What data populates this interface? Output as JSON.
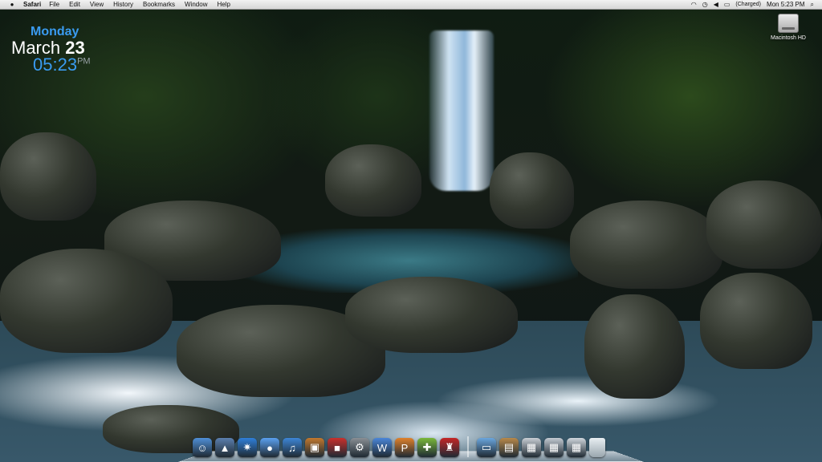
{
  "menubar": {
    "app_name": "Safari",
    "menus": [
      "File",
      "Edit",
      "View",
      "History",
      "Bookmarks",
      "Window",
      "Help"
    ],
    "battery_status": "(Charged)",
    "clock": "Mon 5:23 PM",
    "icons": [
      "apple-icon",
      "wifi-icon",
      "time-machine-icon",
      "volume-icon",
      "battery-icon",
      "spotlight-icon"
    ]
  },
  "date_widget": {
    "day": "Monday",
    "month": "March",
    "date": "23",
    "time": "05:23",
    "ampm": "PM"
  },
  "desktop": {
    "drive_label": "Macintosh HD"
  },
  "dock": {
    "apps": [
      {
        "name": "finder-icon",
        "glyph": "☺",
        "color": "#4f8fd6"
      },
      {
        "name": "preview-icon",
        "glyph": "▲",
        "color": "#5b7fae"
      },
      {
        "name": "safari-icon",
        "glyph": "✷",
        "color": "#2f7fd9"
      },
      {
        "name": "ichat-icon",
        "glyph": "●",
        "color": "#5aa0f0"
      },
      {
        "name": "itunes-icon",
        "glyph": "♫",
        "color": "#3d86d6"
      },
      {
        "name": "iphoto-icon",
        "glyph": "▣",
        "color": "#c1782e"
      },
      {
        "name": "photo-booth-icon",
        "glyph": "■",
        "color": "#c9302c"
      },
      {
        "name": "system-preferences-icon",
        "glyph": "⚙",
        "color": "#8a8f94"
      },
      {
        "name": "word-icon",
        "glyph": "W",
        "color": "#4a86d8"
      },
      {
        "name": "powerpoint-icon",
        "glyph": "P",
        "color": "#e0812a"
      },
      {
        "name": "xbox-icon",
        "glyph": "✚",
        "color": "#7ab83a"
      },
      {
        "name": "front-row-icon",
        "glyph": "♜",
        "color": "#c42626"
      }
    ],
    "stacks": [
      {
        "name": "applications-folder-icon",
        "glyph": "▭",
        "color": "#6aa6de"
      },
      {
        "name": "documents-stack-icon",
        "glyph": "▤",
        "color": "#b8894a"
      },
      {
        "name": "downloads-stack-icon",
        "glyph": "▦",
        "color": "#c9ced4"
      },
      {
        "name": "screenshots-stack-icon",
        "glyph": "▦",
        "color": "#c3cad2"
      },
      {
        "name": "pictures-stack-icon",
        "glyph": "▦",
        "color": "#cfd6dc"
      }
    ]
  }
}
